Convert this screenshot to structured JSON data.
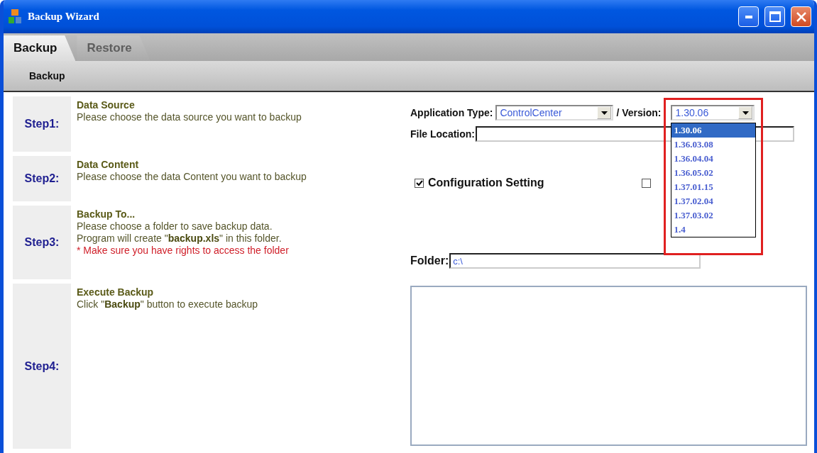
{
  "window": {
    "title": "Backup Wizard"
  },
  "tabs": [
    {
      "label": "Backup",
      "selected": true
    },
    {
      "label": "Restore",
      "selected": false
    }
  ],
  "toolbar": {
    "items": [
      "Backup"
    ]
  },
  "steps": [
    {
      "label": "Step1:",
      "title": "Data Source",
      "lines": [
        "Please choose the data source you want to backup"
      ]
    },
    {
      "label": "Step2:",
      "title": "Data Content",
      "lines": [
        "Please choose the data Content you want to backup"
      ]
    },
    {
      "label": "Step3:",
      "title": "Backup To...",
      "lines": [
        "Please choose a folder to save backup data.",
        "Program will create \"**backup.xls**\" in this folder."
      ],
      "warning": "* Make sure you have rights to access the folder"
    },
    {
      "label": "Step4:",
      "title": "Execute Backup",
      "lines": [
        "Click \"**Backup**\" button to execute backup"
      ]
    }
  ],
  "source": {
    "application_type_label": "Application Type:",
    "application_type": "ControlCenter",
    "version_label": "/ Version:",
    "version": "1.30.06",
    "version_expanded": true,
    "version_options": [
      {
        "label": "1.30.06",
        "selected": true
      },
      {
        "label": "1.36.03.08",
        "selected": false
      },
      {
        "label": "1.36.04.04",
        "selected": false
      },
      {
        "label": "1.36.05.02",
        "selected": false
      },
      {
        "label": "1.37.01.15",
        "selected": false
      },
      {
        "label": "1.37.02.04",
        "selected": false
      },
      {
        "label": "1.37.03.02",
        "selected": false
      },
      {
        "label": "1.4",
        "selected": false
      }
    ],
    "file_location_label": "File Location:"
  },
  "content": {
    "checkboxes": [
      {
        "label": "Configuration Setting",
        "checked": true
      },
      {
        "checked": false
      }
    ]
  },
  "destination": {
    "folder_label": "Folder:",
    "folder": "c:\\"
  }
}
